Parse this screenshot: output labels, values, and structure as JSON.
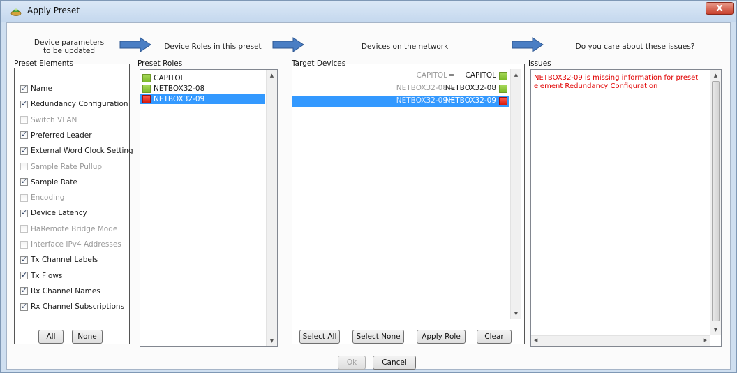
{
  "window": {
    "title": "Apply Preset",
    "close_glyph": "X"
  },
  "steps": [
    {
      "label": "Device parameters to be updated"
    },
    {
      "label": "Device Roles in this preset"
    },
    {
      "label": "Devices on the network"
    },
    {
      "label": "Do you care about these issues?"
    }
  ],
  "preset_elements": {
    "legend": "Preset Elements",
    "items": [
      {
        "label": "Name",
        "checked": true,
        "enabled": true
      },
      {
        "label": "Redundancy Configuration",
        "checked": true,
        "enabled": true
      },
      {
        "label": "Switch VLAN",
        "checked": false,
        "enabled": false
      },
      {
        "label": "Preferred Leader",
        "checked": true,
        "enabled": true
      },
      {
        "label": "External Word Clock Setting",
        "checked": true,
        "enabled": true
      },
      {
        "label": "Sample Rate Pullup",
        "checked": false,
        "enabled": false
      },
      {
        "label": "Sample Rate",
        "checked": true,
        "enabled": true
      },
      {
        "label": "Encoding",
        "checked": false,
        "enabled": false
      },
      {
        "label": "Device Latency",
        "checked": true,
        "enabled": true
      },
      {
        "label": "HaRemote Bridge Mode",
        "checked": false,
        "enabled": false
      },
      {
        "label": "Interface IPv4 Addresses",
        "checked": false,
        "enabled": false
      },
      {
        "label": "Tx Channel Labels",
        "checked": true,
        "enabled": true
      },
      {
        "label": "Tx Flows",
        "checked": true,
        "enabled": true
      },
      {
        "label": "Rx Channel Names",
        "checked": true,
        "enabled": true
      },
      {
        "label": "Rx Channel Subscriptions",
        "checked": true,
        "enabled": true
      }
    ],
    "all_label": "All",
    "none_label": "None"
  },
  "preset_roles": {
    "legend": "Preset Roles",
    "items": [
      {
        "label": "CAPITOL",
        "status": "green",
        "selected": false
      },
      {
        "label": "NETBOX32-08",
        "status": "green",
        "selected": false
      },
      {
        "label": "NETBOX32-09",
        "status": "red",
        "selected": true
      }
    ]
  },
  "target_devices": {
    "legend": "Target Devices",
    "rows": [
      {
        "source": "CAPITOL",
        "eq": "=",
        "target": "CAPITOL",
        "status": "green",
        "selected": false
      },
      {
        "source": "NETBOX32-08",
        "eq": "=",
        "target": "NETBOX32-08",
        "status": "green",
        "selected": false
      },
      {
        "source": "NETBOX32-09",
        "eq": "=",
        "target": "NETBOX32-09",
        "status": "red",
        "selected": true
      }
    ],
    "select_all_label": "Select All",
    "select_none_label": "Select None",
    "apply_role_label": "Apply Role",
    "clear_label": "Clear"
  },
  "issues": {
    "legend": "Issues",
    "text": "NETBOX32-09 is missing information for preset element Redundancy Configuration"
  },
  "footer": {
    "ok_label": "Ok",
    "cancel_label": "Cancel"
  },
  "colors": {
    "selection": "#3399ff",
    "status_green": "#8cc63f",
    "status_red": "#e8241b",
    "issue_text": "#e00000"
  }
}
